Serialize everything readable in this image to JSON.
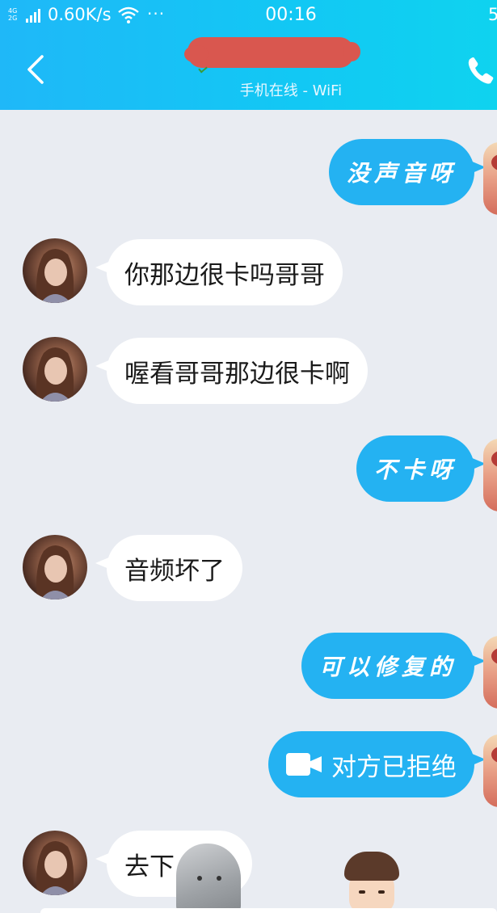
{
  "status_bar": {
    "network_top": "4G",
    "network_bottom": "2G",
    "speed": "0.60K/s",
    "dots": "···",
    "time": "00:16",
    "battery": "5"
  },
  "header": {
    "subtitle": "手机在线 - WiFi"
  },
  "messages": [
    {
      "side": "out",
      "text": "没声音呀"
    },
    {
      "side": "in",
      "text": "你那边很卡吗哥哥"
    },
    {
      "side": "in",
      "text": "喔看哥哥那边很卡啊"
    },
    {
      "side": "out",
      "text": "不卡呀"
    },
    {
      "side": "in",
      "text": "音频坏了"
    },
    {
      "side": "out",
      "text": "可以修复的"
    },
    {
      "side": "out",
      "text": "对方已拒绝",
      "icon": "video-call-icon"
    },
    {
      "side": "in",
      "text": "去下"
    }
  ],
  "colors": {
    "header_start": "#1fb8f8",
    "header_end": "#0fd3ef",
    "chat_bg": "#e9ecf2",
    "out_bubble": "#24b2f2",
    "in_bubble": "#ffffff"
  }
}
